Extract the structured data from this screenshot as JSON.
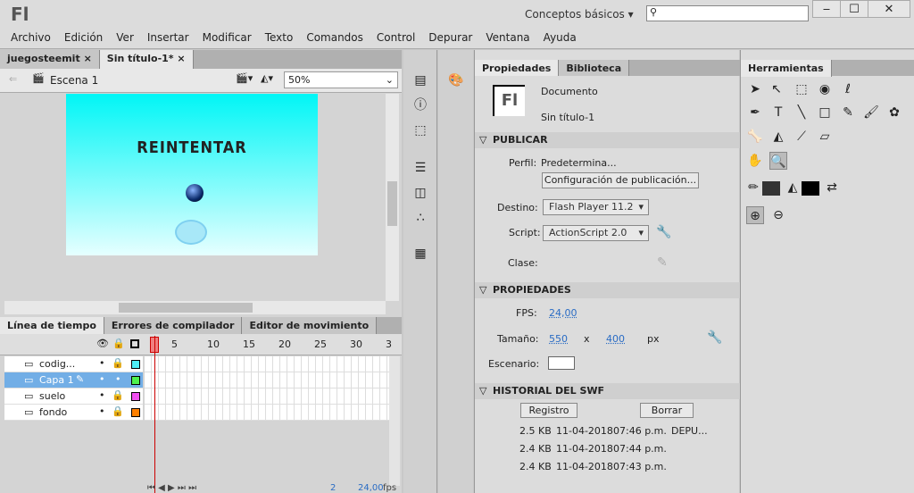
{
  "app": {
    "logo": "Fl",
    "workspace": "Conceptos básicos",
    "window_buttons": [
      "‒",
      "☐",
      "✕"
    ]
  },
  "menu": [
    "Archivo",
    "Edición",
    "Ver",
    "Insertar",
    "Modificar",
    "Texto",
    "Comandos",
    "Control",
    "Depurar",
    "Ventana",
    "Ayuda"
  ],
  "doc_tabs": [
    {
      "label": "juegosteemit"
    },
    {
      "label": "Sin título-1*"
    }
  ],
  "scene": {
    "label": "Escena 1",
    "zoom": "50%"
  },
  "stage": {
    "text": "REINTENTAR"
  },
  "timeline": {
    "tabs": [
      "Línea de tiempo",
      "Errores de compilador",
      "Editor de movimiento"
    ],
    "frame_numbers": [
      "5",
      "10",
      "15",
      "20",
      "25",
      "30",
      "3"
    ],
    "layers": [
      {
        "name": "codig...",
        "color": "#4ff0f8"
      },
      {
        "name": "Capa 1",
        "color": "#4ef04e"
      },
      {
        "name": "suelo",
        "color": "#f04ef0"
      },
      {
        "name": "fondo",
        "color": "#ff8000"
      }
    ],
    "current_frame": "2",
    "fps": "24,00",
    "fps_unit": "fps"
  },
  "properties": {
    "tabs": [
      "Propiedades",
      "Biblioteca"
    ],
    "doc_icon": "Fl",
    "doc_type": "Documento",
    "doc_name": "Sin título-1",
    "publish": {
      "title": "PUBLICAR",
      "profile_label": "Perfil:",
      "profile": "Predetermina...",
      "config_button": "Configuración de publicación...",
      "target_label": "Destino:",
      "target": "Flash Player 11.2",
      "script_label": "Script:",
      "script": "ActionScript 2.0",
      "class_label": "Clase:"
    },
    "props": {
      "title": "PROPIEDADES",
      "fps_label": "FPS:",
      "fps": "24,00",
      "size_label": "Tamaño:",
      "width": "550",
      "x": "x",
      "height": "400",
      "unit": "px",
      "stage_label": "Escenario:",
      "stage_color": "#ffffff"
    },
    "history": {
      "title": "HISTORIAL DEL SWF",
      "log_button": "Registro",
      "clear_button": "Borrar",
      "rows": [
        {
          "size": "2.5 KB",
          "date": "11-04-2018",
          "time": "07:46 p.m.",
          "note": "DEPU..."
        },
        {
          "size": "2.4 KB",
          "date": "11-04-2018",
          "time": "07:44 p.m.",
          "note": ""
        },
        {
          "size": "2.4 KB",
          "date": "11-04-2018",
          "time": "07:43 p.m.",
          "note": ""
        }
      ]
    }
  },
  "tools": {
    "title": "Herramientas",
    "stroke_color": "#333333",
    "fill_color": "#000000"
  }
}
